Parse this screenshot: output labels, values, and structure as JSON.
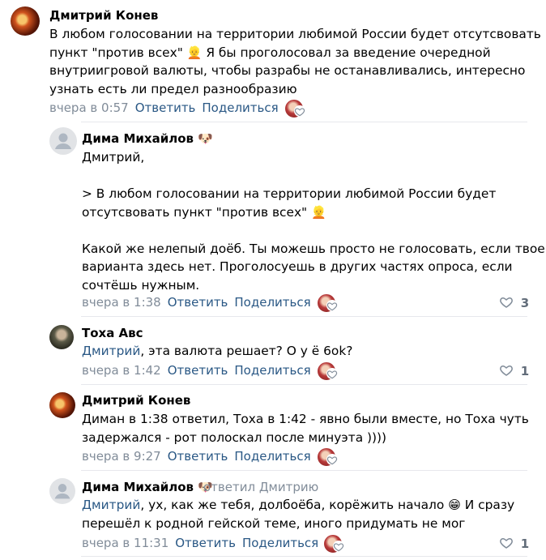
{
  "comments": [
    {
      "author": "Дмитрий Конев",
      "text_lines": [
        "В любом голосовании на территории любимой России будет отсутсвовать",
        "пункт \"против всех\"",
        "внутриигровой валюты, чтобы разрабы не останавливались, интересно",
        "узнать есть ли предел разнообразию"
      ],
      "line2_tail": "Я бы проголосовал за введение очередной",
      "time": "вчера в 0:57",
      "reply": "Ответить",
      "share": "Поделиться"
    },
    {
      "author": "Дима Михайлов",
      "text_lines": [
        "Дмитрий,",
        "",
        "> В любом голосовании на территории любимой России будет",
        "отсутсвовать пункт \"против всех\"",
        "",
        "Какой же нелепый доёб. Ты можешь просто не голосовать, если твоего",
        "варианта здесь нет. Проголосуешь в других частях опроса, если",
        "сочтёшь нужным."
      ],
      "time": "вчера в 1:38",
      "reply": "Ответить",
      "share": "Поделиться",
      "likes": "3"
    },
    {
      "author": "Тоха Авс",
      "mention": "Дмитрий",
      "text_rest": ", эта валюта решает? О у ё 6ok?",
      "time": "вчера в 1:42",
      "reply": "Ответить",
      "share": "Поделиться",
      "likes": "1"
    },
    {
      "author": "Дмитрий Конев",
      "text_lines": [
        "Диман в 1:38 ответил, Тоха в 1:42 - явно были вместе, но Тоха чуть",
        "задержался - рот полоскал после минуэта ))))"
      ],
      "time": "вчера в 9:27",
      "reply": "Ответить",
      "share": "Поделиться"
    },
    {
      "author": "Дима Михайлов",
      "replied_to": "ответил Дмитрию",
      "mention": "Дмитрий",
      "text_rest": ", ух, как же тебя, долбоёба, корёжить начало",
      "text_tail": "И сразу",
      "text_line2": "перешёл к родной гейской теме, иного придумать не мог",
      "time": "вчера в 11:31",
      "reply": "Ответить",
      "share": "Поделиться",
      "likes": "1"
    }
  ],
  "icons": {
    "person_emoji": "👱",
    "dog_emoji": "🐶",
    "grin_emoji": "😁"
  }
}
